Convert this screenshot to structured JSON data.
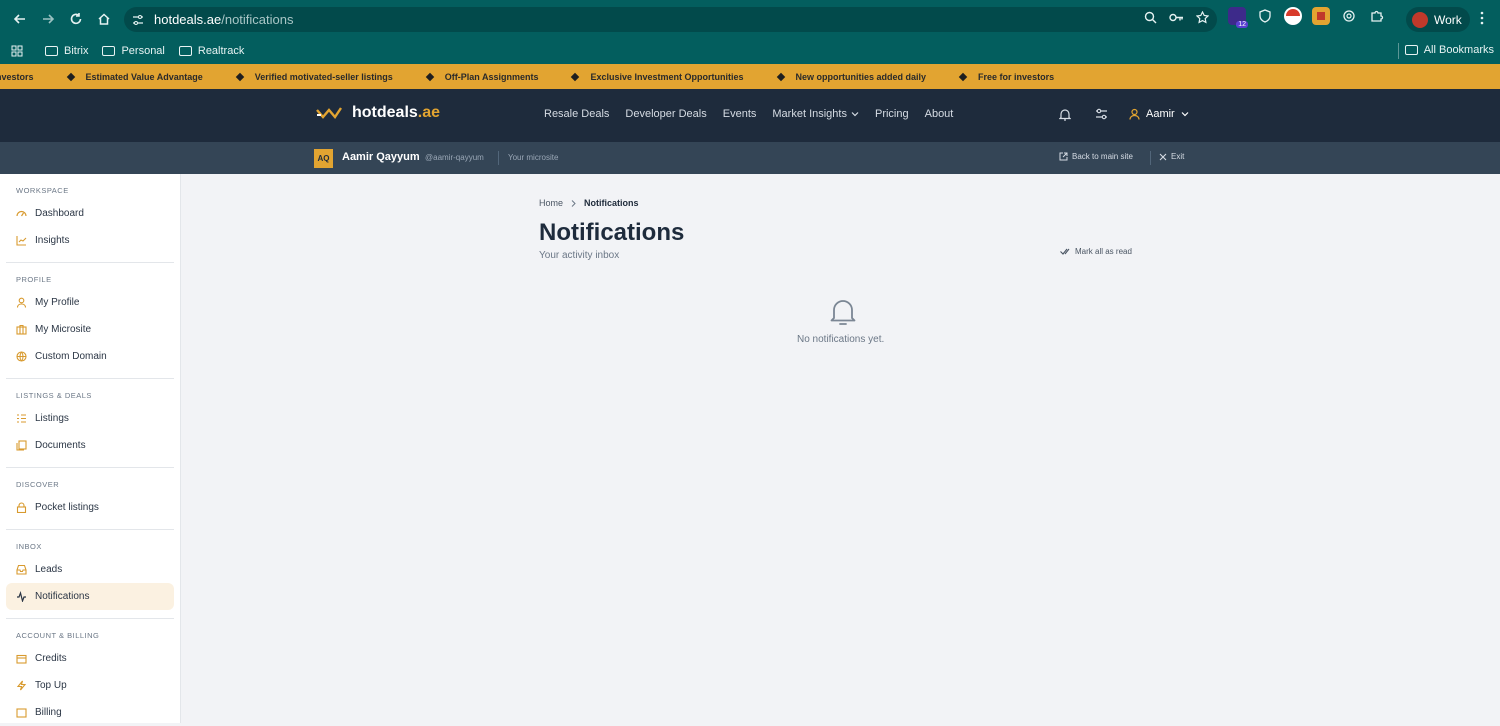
{
  "browser": {
    "url_host": "hotdeals.ae",
    "url_path": "/notifications",
    "profile_label": "Work",
    "extension_badge": "12",
    "bookmarks": [
      "Bitrix",
      "Personal",
      "Realtrack"
    ],
    "all_bookmarks": "All Bookmarks"
  },
  "ticker": [
    "nvestors",
    "Estimated Value Advantage",
    "Verified motivated-seller listings",
    "Off-Plan Assignments",
    "Exclusive Investment Opportunities",
    "New opportunities added daily",
    "Free for investors"
  ],
  "header": {
    "logo_name": "hotdeals",
    "logo_tld": ".ae",
    "nav": [
      "Resale Deals",
      "Developer Deals",
      "Events",
      "Market Insights",
      "Pricing",
      "About"
    ],
    "user": "Aamir"
  },
  "microbar": {
    "initials": "AQ",
    "name": "Aamir Qayyum",
    "handle": "@aamir-qayyum",
    "microsite": "Your microsite",
    "back": "Back to main site",
    "exit": "Exit"
  },
  "sidebar": {
    "sections": [
      {
        "title": "WORKSPACE",
        "items": [
          "Dashboard",
          "Insights"
        ]
      },
      {
        "title": "PROFILE",
        "items": [
          "My Profile",
          "My Microsite",
          "Custom Domain"
        ]
      },
      {
        "title": "LISTINGS & DEALS",
        "items": [
          "Listings",
          "Documents"
        ]
      },
      {
        "title": "DISCOVER",
        "items": [
          "Pocket listings"
        ]
      },
      {
        "title": "INBOX",
        "items": [
          "Leads",
          "Notifications"
        ]
      },
      {
        "title": "ACCOUNT & BILLING",
        "items": [
          "Credits",
          "Top Up",
          "Billing"
        ]
      }
    ]
  },
  "main": {
    "breadcrumb_home": "Home",
    "breadcrumb_current": "Notifications",
    "title": "Notifications",
    "subtitle": "Your activity inbox",
    "mark_all": "Mark all as read",
    "empty": "No notifications yet."
  },
  "colors": {
    "accent": "#e2a431",
    "header": "#1e2b3c",
    "browser": "#035e5e"
  }
}
